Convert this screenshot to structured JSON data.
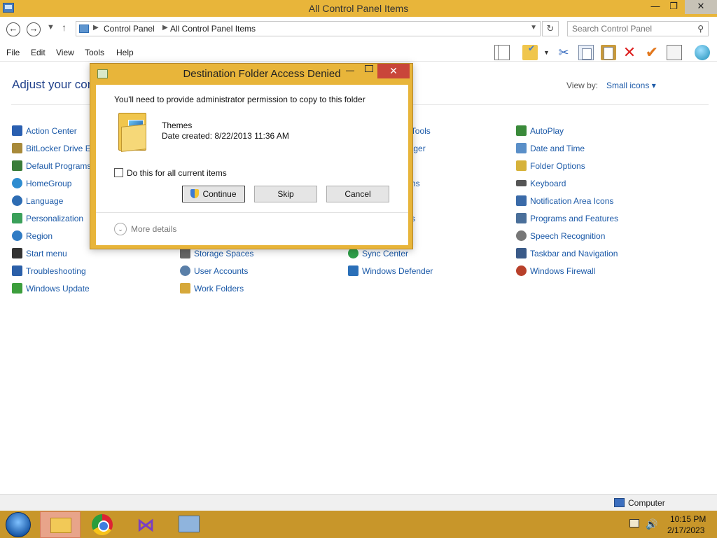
{
  "window": {
    "title": "All Control Panel Items",
    "min": "—",
    "max": "❐",
    "close": "✕"
  },
  "address": {
    "crumbs": [
      "Control Panel",
      "All Control Panel Items"
    ],
    "search_placeholder": "Search Control Panel"
  },
  "menu": [
    "File",
    "Edit",
    "View",
    "Tools",
    "Help"
  ],
  "content": {
    "heading": "Adjust your computer's settings",
    "view_by_label": "View by:",
    "view_by_value": "Small icons ▾",
    "items": [
      {
        "label": "Action Center",
        "color": "#2a5fb0"
      },
      {
        "label": "BitLocker Drive Encryption",
        "color": "#a88a3a"
      },
      {
        "label": "Default Programs",
        "color": "#3a7d3a"
      },
      {
        "label": "HomeGroup",
        "color": "#2e8cd0"
      },
      {
        "label": "Language",
        "color": "#2d6cb3"
      },
      {
        "label": "Personalization",
        "color": "#3aa05a"
      },
      {
        "label": "Region",
        "color": "#2f7bc4"
      },
      {
        "label": "Start menu",
        "color": "#333333"
      },
      {
        "label": "Troubleshooting",
        "color": "#2b5fa8"
      },
      {
        "label": "Windows Update",
        "color": "#3c9e3c"
      },
      {
        "label": "Storage Spaces",
        "color": "#666666"
      },
      {
        "label": "User Accounts",
        "color": "#5a7fa8"
      },
      {
        "label": "Work Folders",
        "color": "#d6a83a"
      },
      {
        "label": "e Tools",
        "color": "#ffffff"
      },
      {
        "label": "nager",
        "color": "#ffffff"
      },
      {
        "label": "ns",
        "color": "#ffffff"
      },
      {
        "label": "s",
        "color": "#ffffff"
      },
      {
        "label": "Sync Center",
        "color": "#2fa04a"
      },
      {
        "label": "Windows Defender",
        "color": "#2a6fb8"
      },
      {
        "label": "AutoPlay",
        "color": "#3a8a3a"
      },
      {
        "label": "Date and Time",
        "color": "#5a8fc8"
      },
      {
        "label": "Folder Options",
        "color": "#d6b23a"
      },
      {
        "label": "Keyboard",
        "color": "#555555"
      },
      {
        "label": "Notification Area Icons",
        "color": "#3a6aa8"
      },
      {
        "label": "Programs and Features",
        "color": "#4a6f9a"
      },
      {
        "label": "Speech Recognition",
        "color": "#777777"
      },
      {
        "label": "Taskbar and Navigation",
        "color": "#3a5a88"
      },
      {
        "label": "Windows Firewall",
        "color": "#b8402a"
      }
    ]
  },
  "status": {
    "computer": "Computer"
  },
  "dialog": {
    "title": "Destination Folder Access Denied",
    "message": "You'll need to provide administrator permission to copy to this folder",
    "folder_name": "Themes",
    "folder_date": "Date created: 8/22/2013 11:36 AM",
    "checkbox_label": "Do this for all current items",
    "continue": "Continue",
    "skip": "Skip",
    "cancel": "Cancel",
    "more_details": "More details"
  },
  "tray": {
    "time": "10:15 PM",
    "date": "2/17/2023"
  }
}
